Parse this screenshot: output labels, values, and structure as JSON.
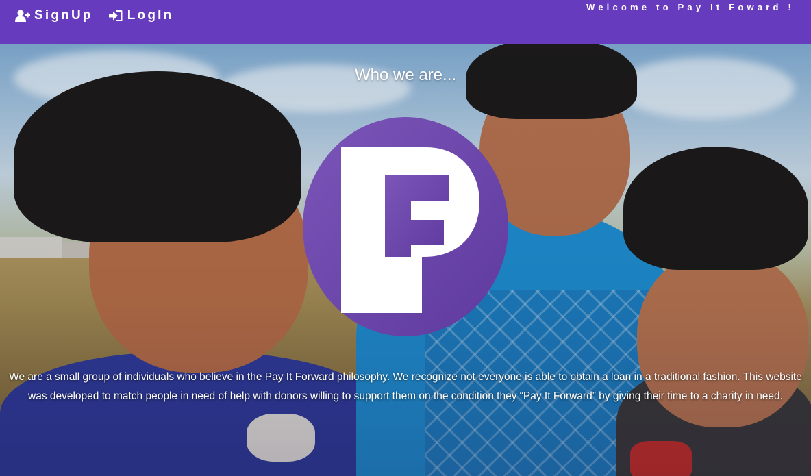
{
  "nav": {
    "signup_label": "SignUp",
    "login_label": "LogIn",
    "signup_icon": "user-plus-icon",
    "login_icon": "sign-in-icon",
    "welcome": "Welcome to Pay It Foward !"
  },
  "hero": {
    "title": "Who we are...",
    "logo_icon": "pif-logo",
    "about": "We are a small group of individuals who believe in the Pay It Forward philosophy. We recognize not everyone is able to obtain a loan in a traditional fashion. This website was developed to match people in need of help with donors willing to support them on the condition they “Pay It Forward” by giving their time to a charity in need."
  },
  "colors": {
    "navbar": "#663bbd",
    "logo_circle": "#6a45a8",
    "logo_letter": "#ffffff"
  }
}
